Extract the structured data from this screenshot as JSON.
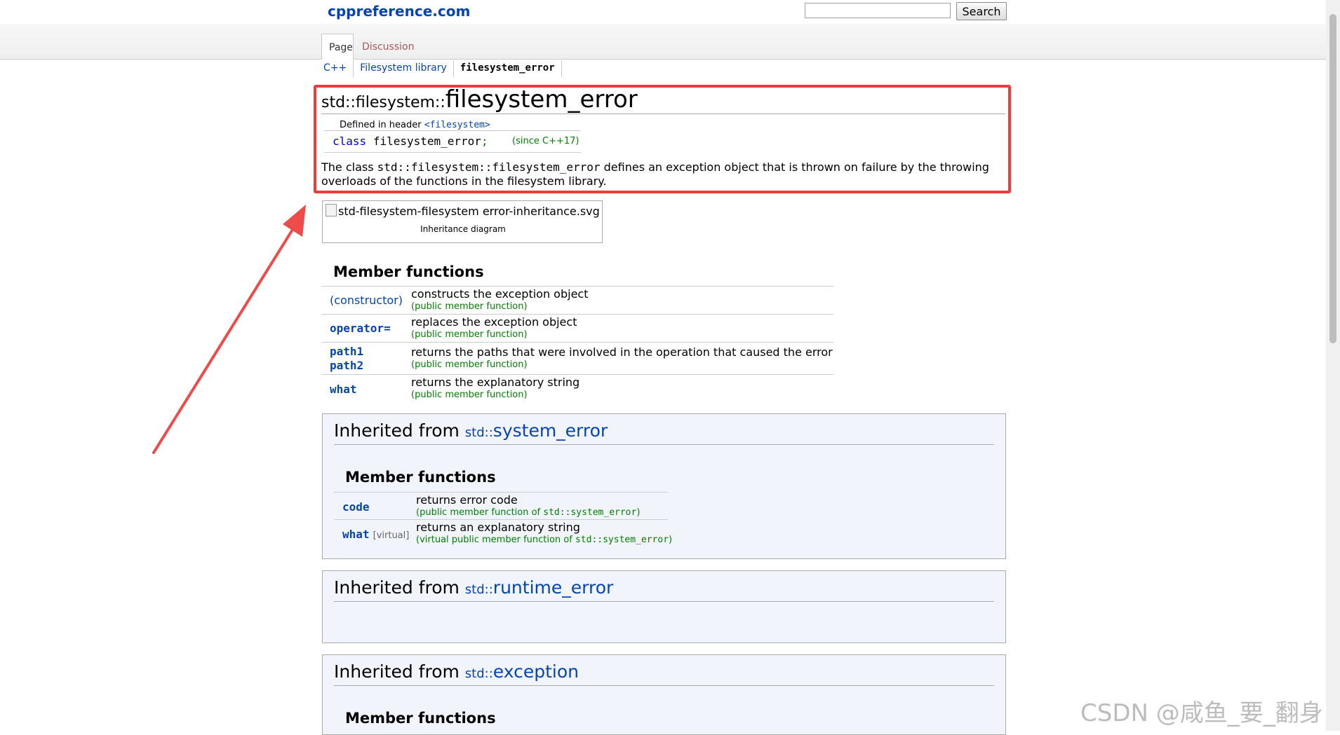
{
  "header": {
    "site_name": "cppreference.com",
    "search_placeholder": "",
    "search_button": "Search",
    "tabs": [
      {
        "label": "Page"
      },
      {
        "label": "Discussion"
      }
    ]
  },
  "breadcrumb": [
    {
      "label": "C++"
    },
    {
      "label": "Filesystem library"
    },
    {
      "label": "filesystem_error"
    }
  ],
  "title": {
    "namespace": "std::filesystem::",
    "name": "filesystem_error"
  },
  "defined_in": {
    "label": "Defined in header",
    "header": "<filesystem>"
  },
  "declaration": {
    "keyword": "class",
    "name": "filesystem_error",
    "punct": ";",
    "since": "(since C++17)"
  },
  "description": {
    "prefix": "The class ",
    "code": "std::filesystem::filesystem_error",
    "suffix": " defines an exception object that is thrown on failure by the throwing overloads of the functions in the filesystem library."
  },
  "diagram": {
    "image_alt": "std-filesystem-filesystem error-inheritance.svg",
    "caption": "Inheritance diagram"
  },
  "member_functions": {
    "heading": "Member functions",
    "rows": [
      {
        "names": [
          "(constructor)"
        ],
        "desc": "constructs the exception object",
        "mark": "(public member function)"
      },
      {
        "names": [
          "operator="
        ],
        "desc": "replaces the exception object",
        "mark": "(public member function)"
      },
      {
        "names": [
          "path1",
          "path2"
        ],
        "desc": "returns the paths that were involved in the operation that caused the error",
        "mark": "(public member function)"
      },
      {
        "names": [
          "what"
        ],
        "desc": "returns the explanatory string",
        "mark": "(public member function)"
      }
    ]
  },
  "inherited": [
    {
      "label": "Inherited from ",
      "ns": "std::",
      "name": "system_error",
      "heading": "Member functions",
      "rows": [
        {
          "name": "code",
          "virtual": "",
          "desc": "returns error code",
          "mark_prefix": "(public member function of ",
          "mark_code": "std::system_error",
          "mark_suffix": ")"
        },
        {
          "name": "what",
          "virtual": "[virtual]",
          "desc": "returns an explanatory string",
          "mark_prefix": "(virtual public member function of ",
          "mark_code": "std::system_error",
          "mark_suffix": ")"
        }
      ]
    },
    {
      "label": "Inherited from ",
      "ns": "std::",
      "name": "runtime_error"
    },
    {
      "label": "Inherited from ",
      "ns": "std::",
      "name": "exception",
      "heading": "Member functions"
    }
  ],
  "watermark": "CSDN @咸鱼_要_翻身",
  "colors": {
    "link": "#0645ad",
    "mark": "#008000",
    "highlight": "#ee3b3b",
    "inherited_bg": "#f2f4fc"
  }
}
